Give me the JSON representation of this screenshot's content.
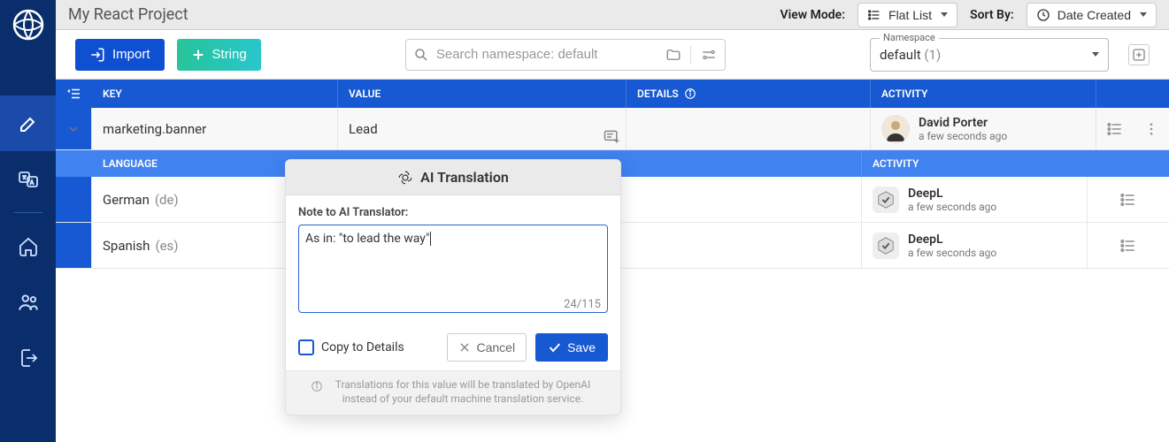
{
  "project_title": "My React Project",
  "top_bar": {
    "view_mode_label": "View Mode:",
    "view_mode_value": "Flat List",
    "sort_label": "Sort By:",
    "sort_value": "Date Created"
  },
  "toolbar": {
    "import_label": "Import",
    "string_label": "String",
    "search_placeholder": "Search namespace: default",
    "namespace_label": "Namespace",
    "namespace_value": "default",
    "namespace_count": "(1)"
  },
  "columns": {
    "key": "KEY",
    "value": "VALUE",
    "details": "DETAILS",
    "activity": "ACTIVITY",
    "language": "LANGUAGE"
  },
  "row": {
    "key": "marketing.banner",
    "value": "Lead",
    "activity": {
      "name": "David Porter",
      "time": "a few seconds ago"
    }
  },
  "languages": [
    {
      "name": "German",
      "code": "(de)",
      "activity": {
        "name": "DeepL",
        "time": "a few seconds ago"
      }
    },
    {
      "name": "Spanish",
      "code": "(es)",
      "activity": {
        "name": "DeepL",
        "time": "a few seconds ago"
      }
    }
  ],
  "popover": {
    "title": "AI Translation",
    "note_label": "Note to AI Translator:",
    "note_value": "As in: \"to lead the way\"",
    "char_count": "24/115",
    "copy_label": "Copy to Details",
    "cancel": "Cancel",
    "save": "Save",
    "footer": "Translations for this value will be translated by OpenAI instead of your default machine translation service."
  }
}
